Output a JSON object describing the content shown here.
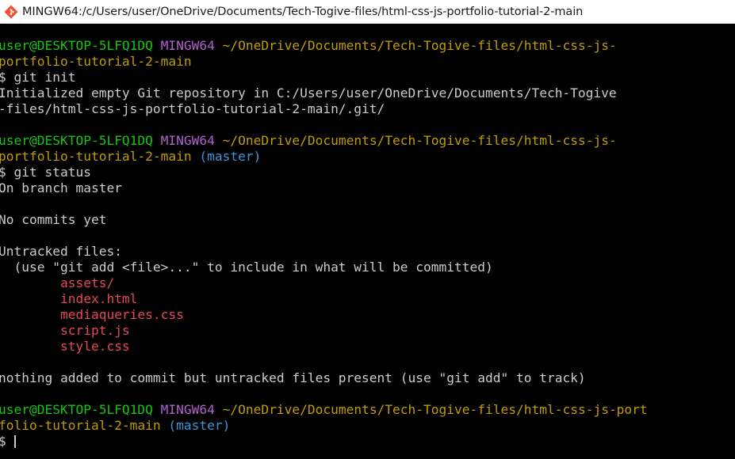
{
  "window": {
    "title": "MINGW64:/c/Users/user/OneDrive/Documents/Tech-Togive-files/html-css-js-portfolio-tutorial-2-main"
  },
  "terminal": {
    "prompt1": {
      "user": "user@DESKTOP-5LFQ1DQ",
      "shell": "MINGW64",
      "path_part1": "~/OneDrive/Documents/Tech-Togive-files/html-css-js-",
      "path_part2": "portfolio-tutorial-2-main"
    },
    "cmd1": "$ git init",
    "init_output": [
      "Initialized empty Git repository in C:/Users/user/OneDrive/Documents/Tech-Togive",
      "-files/html-css-js-portfolio-tutorial-2-main/.git/"
    ],
    "prompt2": {
      "user": "user@DESKTOP-5LFQ1DQ",
      "shell": "MINGW64",
      "path_part1": "~/OneDrive/Documents/Tech-Togive-files/html-css-js-",
      "path_part2": "portfolio-tutorial-2-main",
      "branch": "(master)"
    },
    "cmd2": "$ git status",
    "status_output": {
      "on_branch": "On branch master",
      "no_commits": "No commits yet",
      "untracked_header": "Untracked files:",
      "untracked_hint": "  (use \"git add <file>...\" to include in what will be committed)",
      "files": [
        "assets/",
        "index.html",
        "mediaqueries.css",
        "script.js",
        "style.css"
      ],
      "summary": "nothing added to commit but untracked files present (use \"git add\" to track)"
    },
    "prompt3": {
      "user": "user@DESKTOP-5LFQ1DQ",
      "shell": "MINGW64",
      "path_part1": "~/OneDrive/Documents/Tech-Togive-files/html-css-js-port",
      "path_part2": "folio-tutorial-2-main",
      "branch": "(master)"
    },
    "input_prompt": "$"
  },
  "colors": {
    "user_host": "#16c60c",
    "shell": "#b45fd0",
    "path": "#c19c00",
    "branch": "#3a96dd",
    "untracked_file": "#e74856",
    "text": "#cccccc",
    "background": "#000000"
  }
}
